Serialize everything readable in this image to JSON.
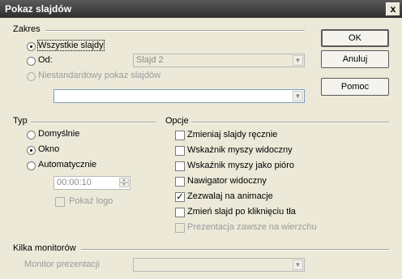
{
  "window": {
    "title": "Pokaz slajdów",
    "close_glyph": "x"
  },
  "range": {
    "label": "Zakres",
    "all_slides": "Wszystkie slajdy",
    "from": "Od:",
    "from_value": "Slajd 2",
    "custom": "Niestandardowy pokaz slajdów",
    "custom_value": ""
  },
  "buttons": {
    "ok": "OK",
    "cancel": "Anuluj",
    "help": "Pomoc"
  },
  "type": {
    "label": "Typ",
    "default": "Domyślnie",
    "window": "Okno",
    "auto": "Automatycznie",
    "pause_value": "00:00:10",
    "show_logo": "Pokaż logo"
  },
  "options": {
    "label": "Opcje",
    "items": [
      "Zmieniaj slajdy ręcznie",
      "Wskaźnik myszy widoczny",
      "Wskaźnik myszy jako pióro",
      "Nawigator widoczny",
      "Zezwalaj na animacje",
      "Zmień slajd po kliknięciu tła",
      "Prezentacja zawsze na wierzchu"
    ],
    "checked": [
      false,
      false,
      false,
      false,
      true,
      false,
      false
    ],
    "disabled": [
      false,
      false,
      false,
      false,
      false,
      false,
      true
    ]
  },
  "monitors": {
    "label": "Kilka monitorów",
    "presentation_monitor": "Monitor prezentacji",
    "monitor_value": ""
  }
}
